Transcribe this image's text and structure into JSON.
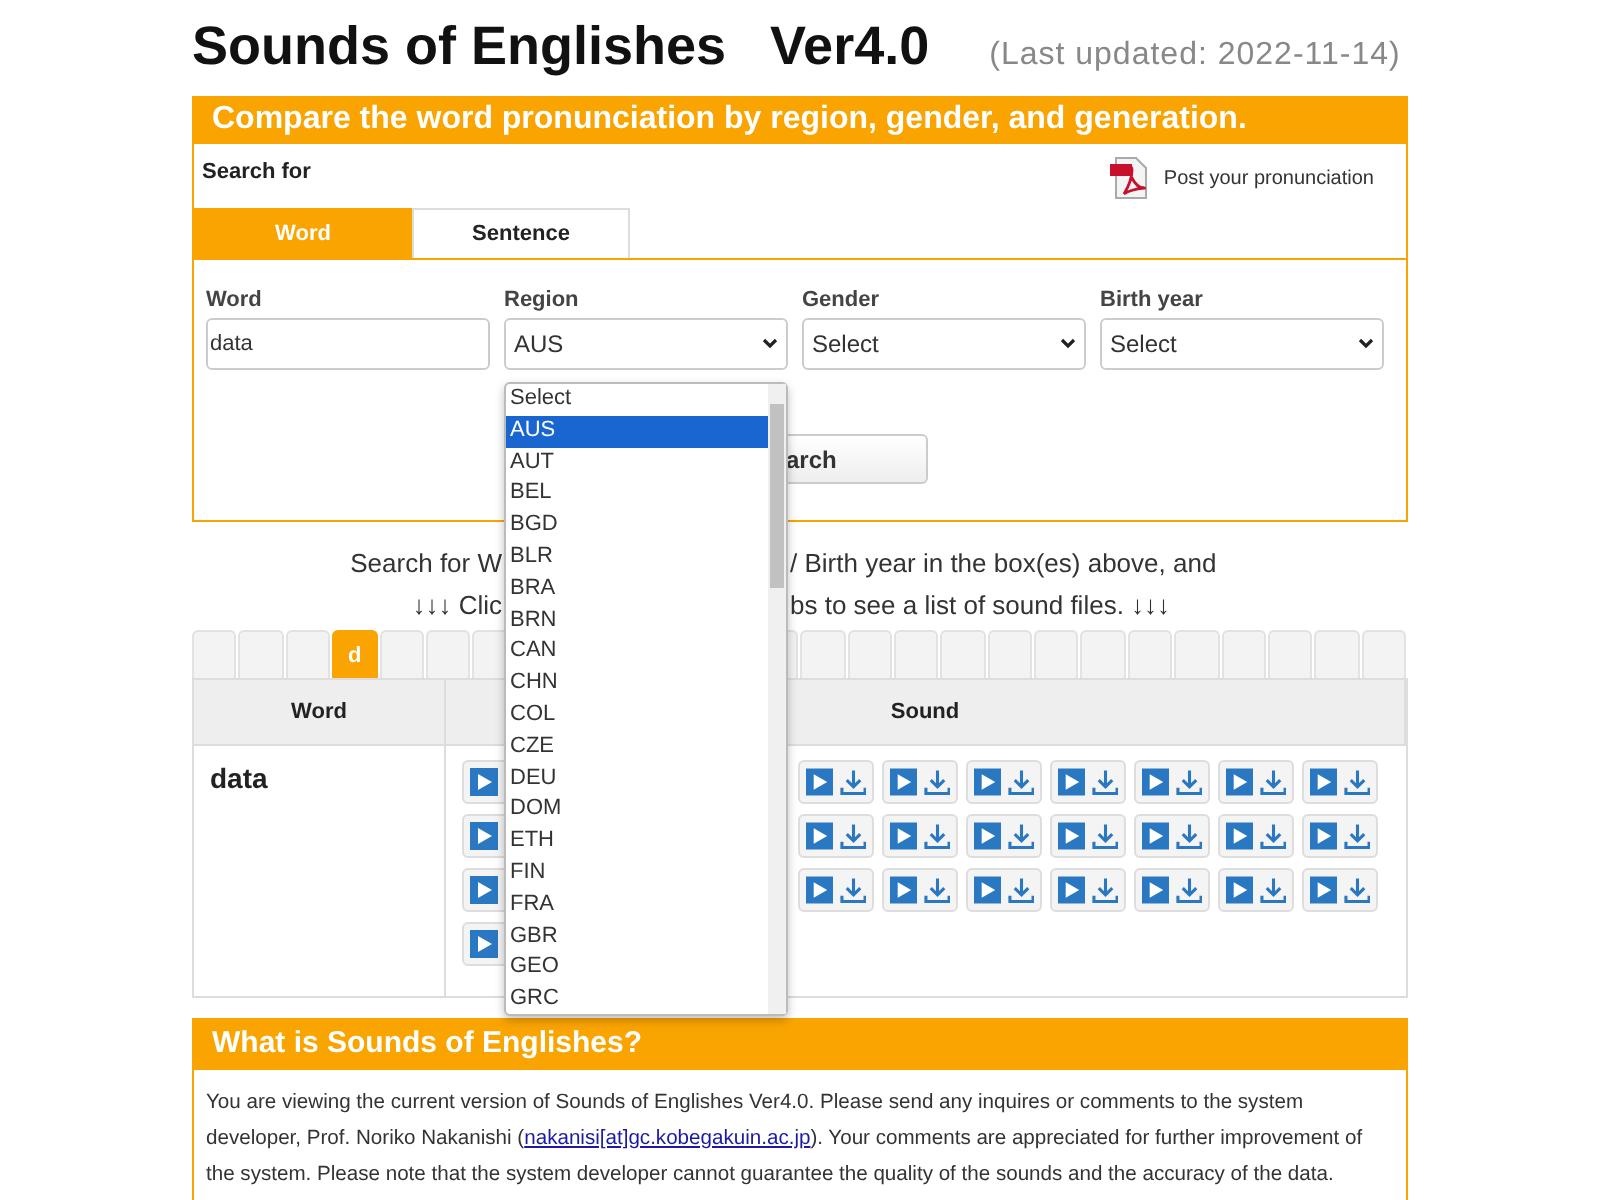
{
  "page_title": {
    "name": "Sounds of Englishes",
    "version": "Ver4.0",
    "updated": "(Last updated: 2022-11-14)"
  },
  "search_panel": {
    "heading": "Compare the word pronunciation by region, gender, and generation.",
    "search_for_label": "Search for",
    "post_link": "Post your pronunciation",
    "tabs": [
      {
        "label": "Word",
        "selected": true
      },
      {
        "label": "Sentence",
        "selected": false
      }
    ],
    "fields": [
      {
        "kind": "text",
        "label": "Word",
        "value": "data"
      },
      {
        "kind": "select",
        "label": "Region",
        "value": "AUS",
        "options": [
          {
            "label": "Select",
            "selected": false
          },
          {
            "label": "AUS",
            "selected": true
          },
          {
            "label": "AUT",
            "selected": false
          },
          {
            "label": "BEL",
            "selected": false
          },
          {
            "label": "BGD",
            "selected": false
          },
          {
            "label": "BLR",
            "selected": false
          },
          {
            "label": "BRA",
            "selected": false
          },
          {
            "label": "BRN",
            "selected": false
          },
          {
            "label": "CAN",
            "selected": false
          },
          {
            "label": "CHN",
            "selected": false
          },
          {
            "label": "COL",
            "selected": false
          },
          {
            "label": "CZE",
            "selected": false
          },
          {
            "label": "DEU",
            "selected": false
          },
          {
            "label": "DOM",
            "selected": false
          },
          {
            "label": "ETH",
            "selected": false
          },
          {
            "label": "FIN",
            "selected": false
          },
          {
            "label": "FRA",
            "selected": false
          },
          {
            "label": "GBR",
            "selected": false
          },
          {
            "label": "GEO",
            "selected": false
          },
          {
            "label": "GRC",
            "selected": false
          }
        ]
      },
      {
        "kind": "select",
        "label": "Gender",
        "value": "Select"
      },
      {
        "kind": "select",
        "label": "Birth year",
        "value": "Select"
      }
    ],
    "search_button": "arch"
  },
  "instructions": [
    {
      "left": "Search for W",
      "right": "/ Birth year in the box(es) above, and"
    },
    {
      "left": "↓↓↓ Clic",
      "right": "bs to see a list of sound files. ↓↓↓"
    }
  ],
  "letter_tab_groups": [
    [
      {
        "selected": false
      },
      {
        "selected": false
      },
      {
        "selected": false
      },
      {
        "label": "d",
        "selected": true
      },
      {
        "selected": false
      },
      {
        "selected": false
      },
      {
        "selected": false
      }
    ],
    [
      {
        "selected": false
      },
      {
        "selected": false
      },
      {
        "selected": false
      },
      {
        "selected": false
      },
      {
        "selected": false
      },
      {
        "selected": false
      },
      {
        "selected": false
      },
      {
        "selected": false
      },
      {
        "selected": false
      },
      {
        "selected": false
      },
      {
        "selected": false
      },
      {
        "selected": false
      },
      {
        "selected": false
      },
      {
        "selected": false
      }
    ]
  ],
  "results": {
    "columns": [
      "Word",
      "Sound"
    ],
    "rows": [
      {
        "word": "data",
        "sound_rows": [
          [
            [
              {
                "kind": "play"
              }
            ],
            [
              {
                "kind": "play_download"
              },
              {
                "kind": "play_download"
              },
              {
                "kind": "play_download"
              },
              {
                "kind": "play_download"
              },
              {
                "kind": "play_download"
              },
              {
                "kind": "play_download"
              },
              {
                "kind": "play_download"
              }
            ]
          ],
          [
            [
              {
                "kind": "play"
              }
            ],
            [
              {
                "kind": "play_download"
              },
              {
                "kind": "play_download"
              },
              {
                "kind": "play_download"
              },
              {
                "kind": "play_download"
              },
              {
                "kind": "play_download"
              },
              {
                "kind": "play_download"
              },
              {
                "kind": "play_download"
              }
            ]
          ],
          [
            [
              {
                "kind": "play"
              }
            ],
            [
              {
                "kind": "play_download"
              },
              {
                "kind": "play_download"
              },
              {
                "kind": "play_download"
              },
              {
                "kind": "play_download"
              },
              {
                "kind": "play_download"
              },
              {
                "kind": "play_download"
              },
              {
                "kind": "play_download"
              }
            ]
          ],
          [
            [
              {
                "kind": "play"
              }
            ]
          ]
        ]
      }
    ]
  },
  "about": {
    "heading": "What is Sounds of Englishes?",
    "text": "You are viewing the current version of Sounds of Englishes Ver4.0. Please send any inquires or comments to the system developer, Prof. Noriko Nakanishi (",
    "link": "nakanisi[at]gc.kobegakuin.ac.jp",
    "text_after": "). Your comments are appreciated for further improvement of the system. Please note that the system developer cannot guarantee the quality of the sounds and the accuracy of the data."
  }
}
